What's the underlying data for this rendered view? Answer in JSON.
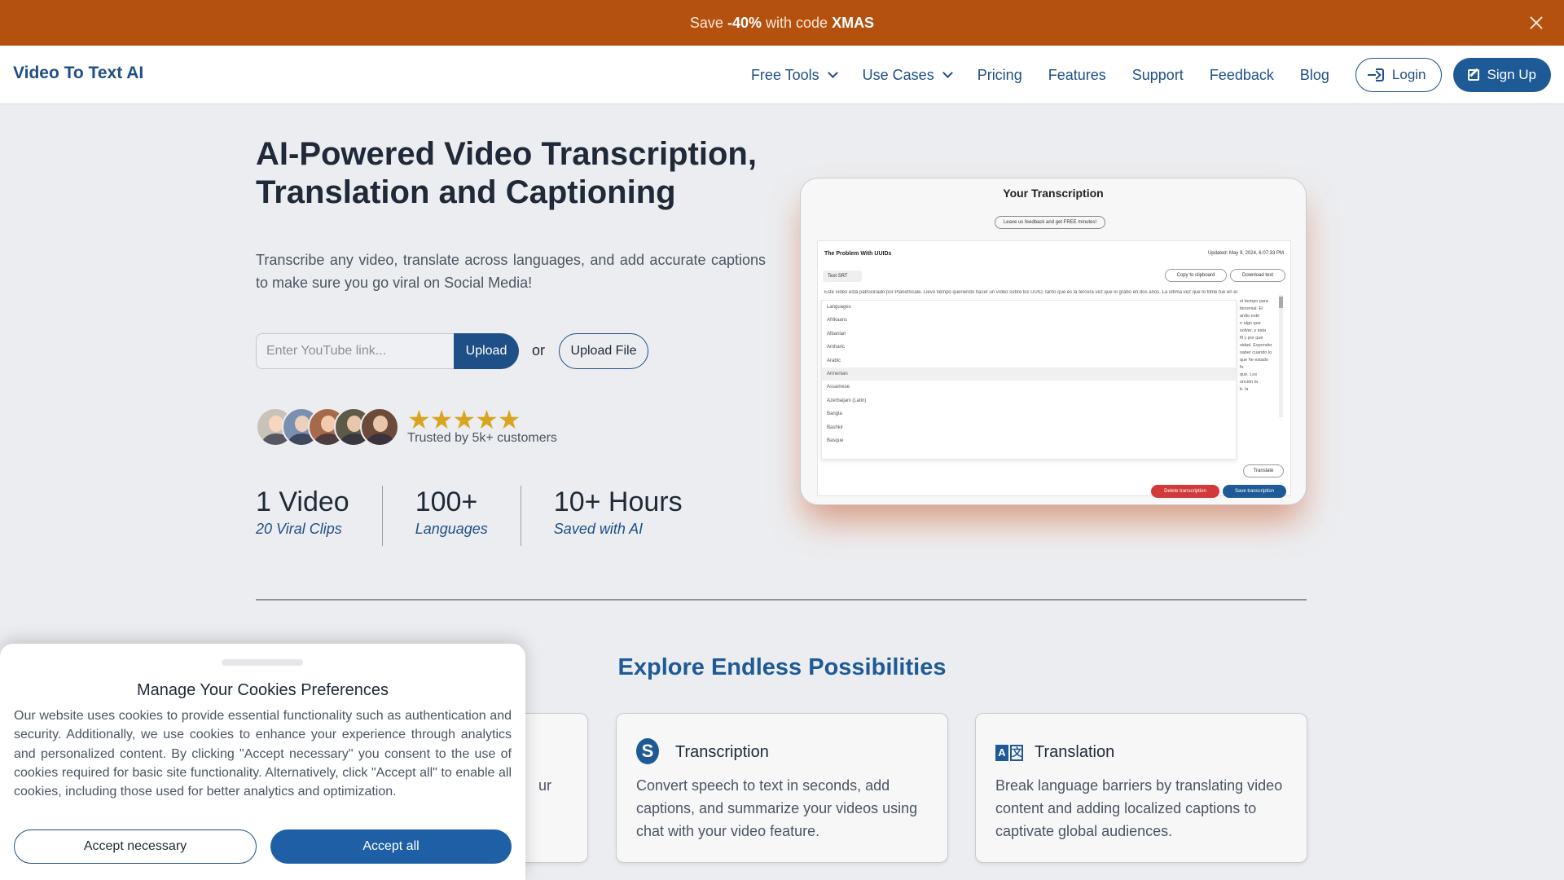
{
  "promo": {
    "prefix": "Save ",
    "discount": "-40%",
    "middle": " with code ",
    "code": "XMAS"
  },
  "nav": {
    "logo": "Video To Text AI",
    "items": [
      "Free Tools",
      "Use Cases",
      "Pricing",
      "Features",
      "Support",
      "Feedback",
      "Blog"
    ],
    "login": "Login",
    "signup": "Sign Up"
  },
  "hero": {
    "title_line1": "AI-Powered Video Transcription,",
    "title_line2": "Translation and Captioning",
    "subtitle": "Transcribe any video, translate across languages, and add accurate captions to make sure you go viral on Social Media!",
    "input_placeholder": "Enter YouTube link...",
    "upload": "Upload",
    "or": "or",
    "upload_file": "Upload File",
    "stars": "★★★★★",
    "trusted": "Trusted by 5k+ customers"
  },
  "stats": [
    {
      "value": "1 Video",
      "label": "20 Viral Clips"
    },
    {
      "value": "100+",
      "label": "Languages"
    },
    {
      "value": "10+ Hours",
      "label": "Saved with AI"
    }
  ],
  "preview": {
    "title": "Your Transcription",
    "feedback": "Leave us feedback and get FREE minutes!",
    "doc_title": "The Problem With UUIDs",
    "updated": "Updated: May 9, 2024, 6:07:33 PM",
    "tabs": "Text    SRT",
    "copy": "Copy to clipboard",
    "download": "Download text",
    "text": "Este vídeo está patrocinado por PlanetScale. Llevo tiempo queriendo hacer un vídeo sobre los UUID, tanto que es la tercera vez que lo grabo en dos años. La última vez que lo filmé fue en el",
    "languages": [
      "Languages",
      "Afrikaans",
      "Albanian",
      "Amharic",
      "Arabic",
      "Armenian",
      "Assamese",
      "Azerbaijani (Latin)",
      "Bangla",
      "Bashkir",
      "Basque"
    ],
    "right_text": "el tiempo para\nbinomial. El\nando este\nn algo que\nsolver, y esta\nfil y por qué\nsidad. Esponder\nsaber cuando lo\nque he estado\nfe\nqué. Los\nunción la\nb. la",
    "translate": "Translate",
    "delete": "Delete transcription",
    "save": "Save transcription"
  },
  "explore": {
    "title": "Explore Endless Possibilities"
  },
  "features": [
    {
      "title": "",
      "desc": "ur"
    },
    {
      "title": "Transcription",
      "desc": "Convert speech to text in seconds, add captions, and summarize your videos using chat with your video feature."
    },
    {
      "title": "Translation",
      "desc": "Break language barriers by translating video content and adding localized captions to captivate global audiences."
    }
  ],
  "cookie": {
    "title": "Manage Your Cookies Preferences",
    "body": "Our website uses cookies to provide essential functionality such as authentication and security. Additionally, we use cookies to enhance your experience through analytics and personalized content. By clicking \"Accept necessary\" you consent to the use of cookies required for basic site functionality. Alternatively, click \"Accept all\" to enable all cookies, including those used for better analytics and optimization.",
    "accept_necessary": "Accept necessary",
    "accept_all": "Accept all"
  },
  "colors": {
    "brand": "#1e4f86",
    "promo": "#b4510f",
    "star": "#d8a520",
    "danger": "#d23a3a"
  },
  "icons": [
    "close-icon",
    "chevron-down-icon",
    "login-icon",
    "signup-icon",
    "transcription-s-icon",
    "translation-az-icon"
  ]
}
